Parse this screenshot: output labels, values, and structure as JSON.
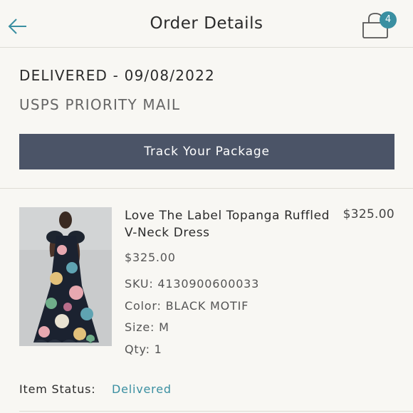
{
  "header": {
    "title": "Order Details",
    "bag_count": "4",
    "accent_color": "#3a8fa1"
  },
  "shipment": {
    "status": "DELIVERED - 09/08/2022",
    "carrier": "USPS PRIORITY MAIL",
    "track_label": "Track Your Package",
    "button_color": "#4b5467"
  },
  "item": {
    "name": "Love The Label Topanga Ruffled V-Neck Dress",
    "line_total": "$325.00",
    "unit_price": "$325.00",
    "sku": "SKU: 4130900600033",
    "color": "Color: BLACK MOTIF",
    "size": "Size: M",
    "qty": "Qty: 1",
    "status_label": "Item Status:",
    "status_value": "Delivered"
  },
  "icons": {
    "back": "arrow-left-icon",
    "bag": "shopping-bag-icon"
  }
}
